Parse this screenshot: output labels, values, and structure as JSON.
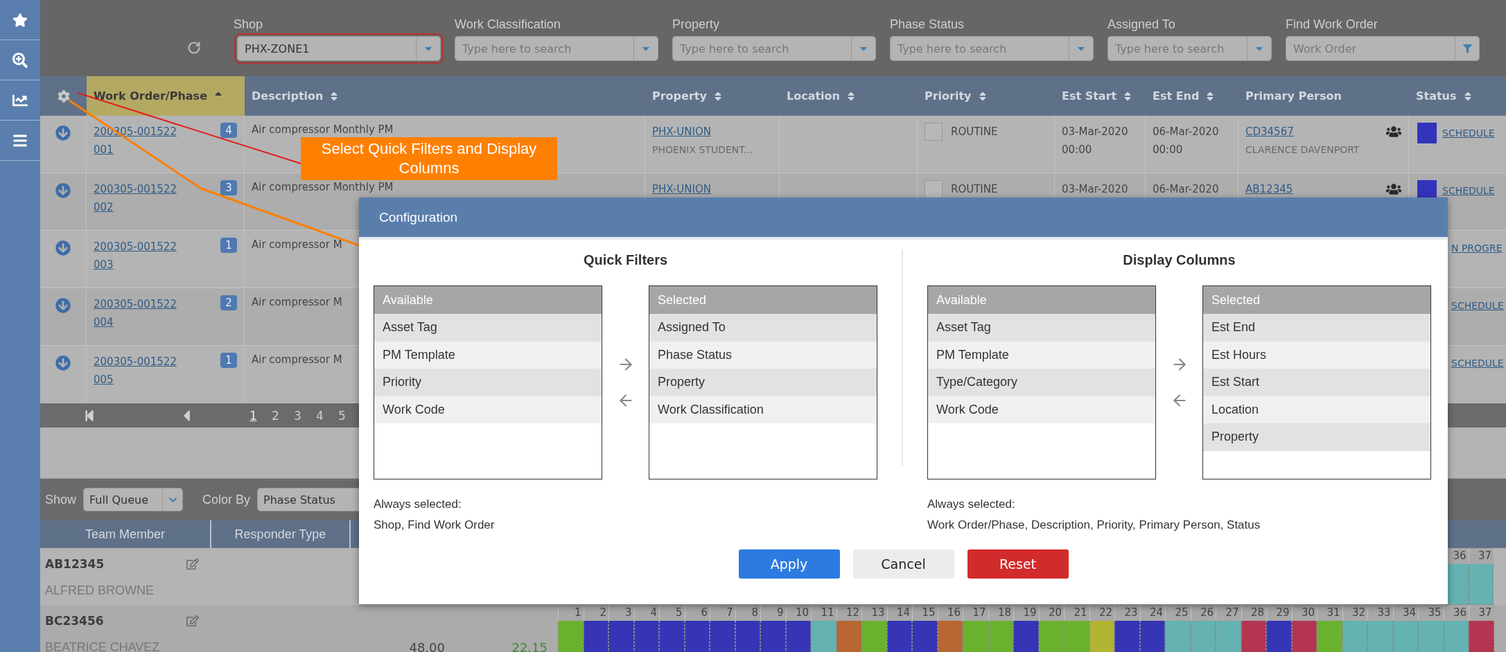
{
  "filters": [
    {
      "label": "Shop",
      "kind": "select",
      "value": "PHX-ZONE1",
      "highlighted": true
    },
    {
      "label": "Work Classification",
      "kind": "select",
      "placeholder": "Type here to search",
      "highlighted": false
    },
    {
      "label": "Property",
      "kind": "select",
      "placeholder": "Type here to search",
      "highlighted": false
    },
    {
      "label": "Phase Status",
      "kind": "select",
      "placeholder": "Type here to search",
      "highlighted": false
    },
    {
      "label": "Assigned To",
      "kind": "select",
      "placeholder": "Type here to search",
      "highlighted": false
    },
    {
      "label": "Find Work Order",
      "kind": "filter",
      "placeholder": "Work Order",
      "highlighted": false
    }
  ],
  "table": {
    "columns": [
      {
        "label": "Work Order/Phase",
        "sortable": true,
        "sorted": true
      },
      {
        "label": "Description",
        "sortable": true,
        "sorted": false
      },
      {
        "label": "Property",
        "sortable": true,
        "sorted": false
      },
      {
        "label": "Location",
        "sortable": true,
        "sorted": false
      },
      {
        "label": "Priority",
        "sortable": true,
        "sorted": false
      },
      {
        "label": "Est Start",
        "sortable": true,
        "sorted": false
      },
      {
        "label": "Est End",
        "sortable": true,
        "sorted": false
      },
      {
        "label": "Primary Person",
        "sortable": false,
        "sorted": false
      },
      {
        "label": "Status",
        "sortable": true,
        "sorted": false
      }
    ],
    "rows": [
      {
        "work_order": "200305-001522",
        "phase": "001",
        "count": "4",
        "description": "Air compressor Monthly PM",
        "property": "PHX-UNION",
        "property_name": "PHOENIX STUDENT...",
        "priority": "ROUTINE",
        "est_start": [
          "03-Mar-2020",
          "00:00"
        ],
        "est_end": [
          "06-Mar-2020",
          "00:00"
        ],
        "person_id": "CD34567",
        "person_name": "CLARENCE DAVENPORT",
        "status": "SCHEDULE",
        "color": "#3333bb"
      },
      {
        "work_order": "200305-001522",
        "phase": "002",
        "count": "3",
        "description": "Air compressor Monthly PM",
        "property": "PHX-UNION",
        "priority": "ROUTINE",
        "est_start": [
          "03-Mar-2020"
        ],
        "est_end": [
          "06-Mar-2020"
        ],
        "person_id": "AB12345",
        "status": "SCHEDULE",
        "color": "#3333bb"
      },
      {
        "work_order": "200305-001522",
        "phase": "003",
        "count": "1",
        "description": "Air compressor M",
        "status": "N PROGRE"
      },
      {
        "work_order": "200305-001522",
        "phase": "004",
        "count": "2",
        "description": "Air compressor M",
        "status": "SCHEDULE"
      },
      {
        "work_order": "200305-001522",
        "phase": "005",
        "count": "1",
        "description": "Air compressor M",
        "status": "SCHEDULE"
      }
    ]
  },
  "pager": {
    "pages": [
      {
        "label": "1",
        "selected": true
      },
      {
        "label": "2",
        "selected": false
      },
      {
        "label": "3",
        "selected": false
      },
      {
        "label": "4",
        "selected": false
      },
      {
        "label": "5",
        "selected": false
      }
    ]
  },
  "queue_bar": {
    "show_label": "Show",
    "show_value": "Full Queue",
    "color_by_label": "Color By",
    "color_by_value": "Phase Status"
  },
  "team": {
    "columns": [
      "Team Member",
      "Responder Type"
    ],
    "members": [
      {
        "id": "AB12345",
        "name": "ALFRED BROWNE",
        "days": [
          {
            "label": "36",
            "color": "#64b2b2"
          },
          {
            "label": "37",
            "color": "#64b2b2"
          }
        ]
      },
      {
        "id": "BC23456",
        "name": "BEATRICE CHAVEZ",
        "hours": "48.00",
        "remaining": "22.15",
        "days": [
          {
            "label": "1",
            "color": "#6ab22e"
          },
          {
            "label": "2",
            "color": "#3535b5"
          },
          {
            "label": "3",
            "color": "#3535b5"
          },
          {
            "label": "4",
            "color": "#3535b5"
          },
          {
            "label": "5",
            "color": "#3535b5"
          },
          {
            "label": "6",
            "color": "#3535b5"
          },
          {
            "label": "7",
            "color": "#3535b5"
          },
          {
            "label": "8",
            "color": "#3535b5"
          },
          {
            "label": "9",
            "color": "#3535b5"
          },
          {
            "label": "10",
            "color": "#3535b5"
          },
          {
            "label": "11",
            "color": "#64b2b2"
          },
          {
            "label": "12",
            "color": "#b86632"
          },
          {
            "label": "13",
            "color": "#6ab22e"
          },
          {
            "label": "14",
            "color": "#3535b5"
          },
          {
            "label": "15",
            "color": "#3535b5"
          },
          {
            "label": "16",
            "color": "#b86632"
          },
          {
            "label": "17",
            "color": "#6ab22e"
          },
          {
            "label": "18",
            "color": "#6ab22e"
          },
          {
            "label": "19",
            "color": "#3535b5"
          },
          {
            "label": "20",
            "color": "#6ab22e"
          },
          {
            "label": "21",
            "color": "#6ab22e"
          },
          {
            "label": "22",
            "color": "#b2b433"
          },
          {
            "label": "23",
            "color": "#3535b5"
          },
          {
            "label": "24",
            "color": "#3535b5"
          },
          {
            "label": "25",
            "color": "#64b2b2"
          },
          {
            "label": "26",
            "color": "#64b2b2"
          },
          {
            "label": "27",
            "color": "#64b2b2"
          },
          {
            "label": "28",
            "color": "#b3354f"
          },
          {
            "label": "29",
            "color": "#3535b5"
          },
          {
            "label": "30",
            "color": "#b3354f"
          },
          {
            "label": "31",
            "color": "#6ab22e"
          },
          {
            "label": "32",
            "color": "#64b2b2"
          },
          {
            "label": "33",
            "color": "#64b2b2"
          },
          {
            "label": "34",
            "color": "#64b2b2"
          },
          {
            "label": "35",
            "color": "#64b2b2"
          },
          {
            "label": "36",
            "color": "#64b2b2"
          },
          {
            "label": "37",
            "color": "#b3354f"
          }
        ]
      }
    ]
  },
  "callout": {
    "text": "Select Quick Filters and Display Columns"
  },
  "dialog": {
    "title": "Configuration",
    "sections": [
      {
        "title": "Quick Filters",
        "lists": [
          {
            "heading": "Available",
            "items": [
              "Asset Tag",
              "PM Template",
              "Priority",
              "Work Code"
            ]
          },
          {
            "heading": "Selected",
            "items": [
              "Assigned To",
              "Phase Status",
              "Property",
              "Work Classification"
            ]
          }
        ],
        "always_label": "Always selected:",
        "always": "Shop, Find Work Order"
      },
      {
        "title": "Display Columns",
        "lists": [
          {
            "heading": "Available",
            "items": [
              "Asset Tag",
              "PM Template",
              "Type/Category",
              "Work Code"
            ]
          },
          {
            "heading": "Selected",
            "items": [
              "Est End",
              "Est Hours",
              "Est Start",
              "Location",
              "Property"
            ]
          }
        ],
        "always_label": "Always selected:",
        "always": "Work Order/Phase, Description, Priority, Primary Person, Status"
      }
    ],
    "buttons": [
      {
        "label": "Apply",
        "kind": "primary"
      },
      {
        "label": "Cancel",
        "kind": "secondary"
      },
      {
        "label": "Reset",
        "kind": "danger"
      }
    ]
  }
}
